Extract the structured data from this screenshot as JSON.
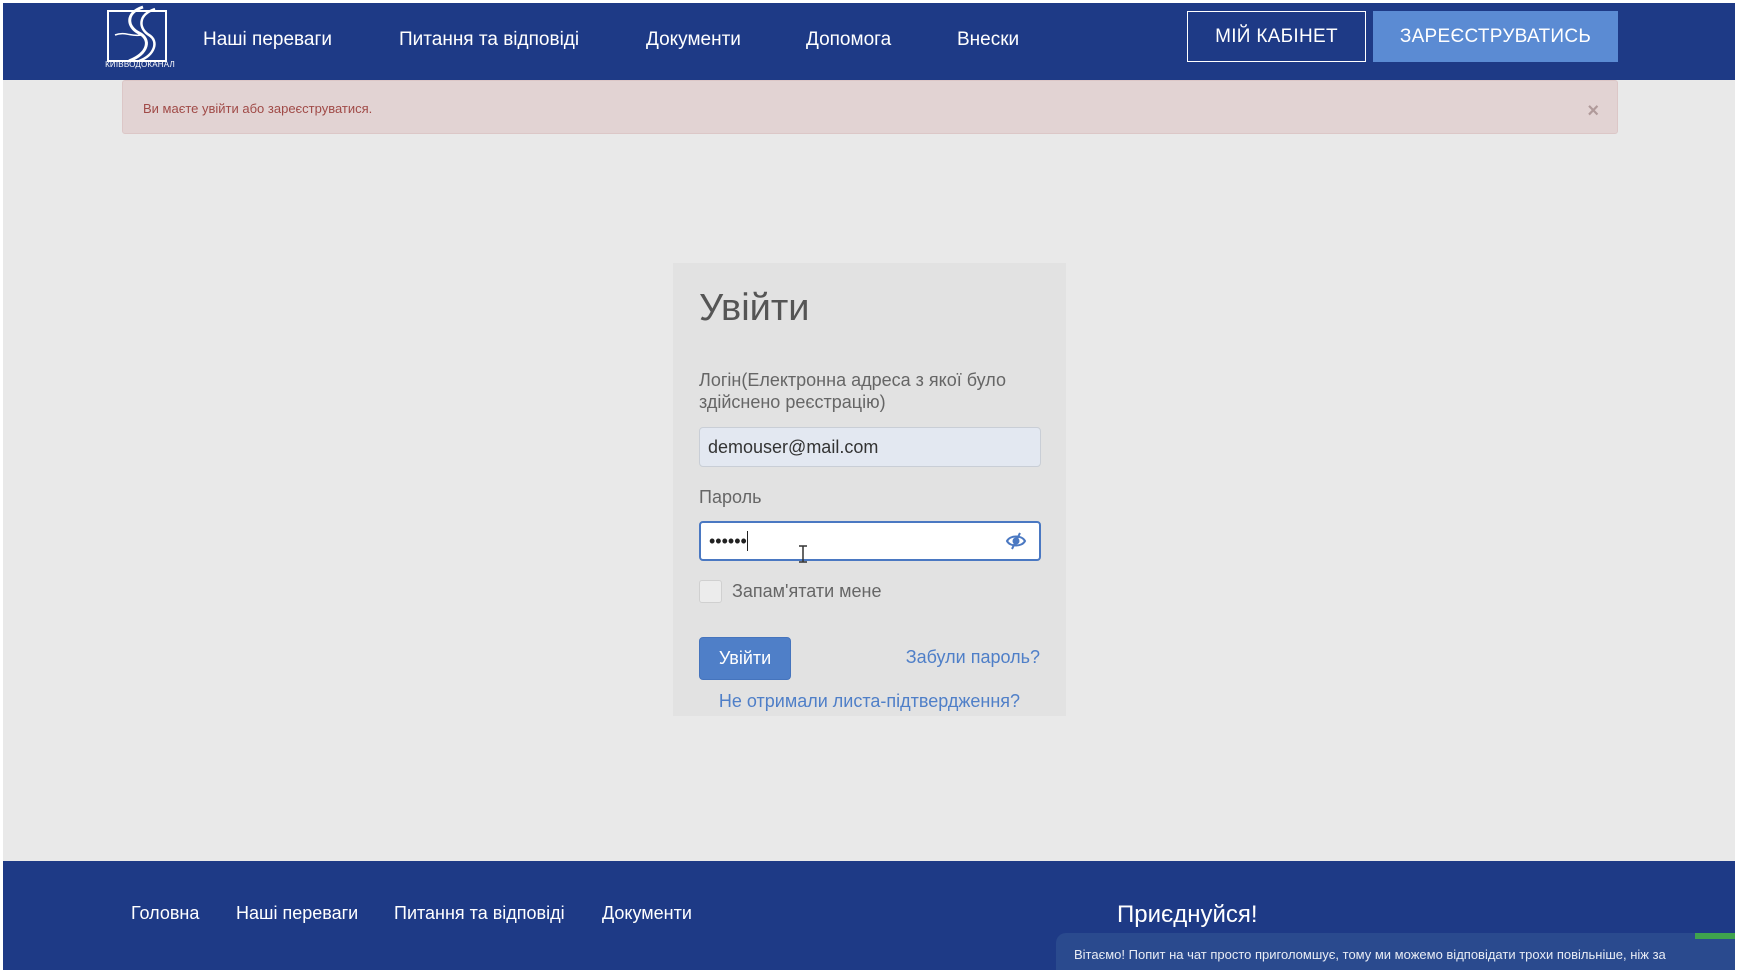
{
  "header": {
    "logo_text": "КИЇВВОДОКАНАЛ",
    "nav": [
      {
        "label": "Наші переваги"
      },
      {
        "label": "Питання та відповіді"
      },
      {
        "label": "Документи"
      },
      {
        "label": "Допомога"
      },
      {
        "label": "Внески"
      }
    ],
    "cabinet_label": "МІЙ КАБІНЕТ",
    "register_label": "ЗАРЕЄСТРУВАТИСЬ"
  },
  "alert": {
    "text": "Ви маєте увійти або зареєструватися.",
    "close": "×"
  },
  "login": {
    "title": "Увійти",
    "login_label": "Логін(Електронна адреса з якої було здійснено реєстрацію)",
    "login_value": "demouser@mail.com",
    "password_label": "Пароль",
    "password_value": "••••••",
    "remember_label": "Запам'ятати мене",
    "submit_label": "Увійти",
    "forgot_label": "Забули пароль?",
    "confirm_label": "Не отримали листа-підтвердження?"
  },
  "footer": {
    "links": [
      {
        "label": "Головна"
      },
      {
        "label": "Наші переваги"
      },
      {
        "label": "Питання та відповіді"
      },
      {
        "label": "Документи"
      }
    ],
    "join_label": "Приєднуйся!",
    "chat_text": "Вітаємо! Попит на чат просто приголомшує, тому ми можемо відповідати трохи повільніше, ніж за"
  },
  "colors": {
    "header_bg": "#1e3a86",
    "accent": "#4f7fc8",
    "register_bg": "#5b8bd3",
    "alert_bg": "#e2d3d3",
    "alert_text": "#a04a47"
  }
}
